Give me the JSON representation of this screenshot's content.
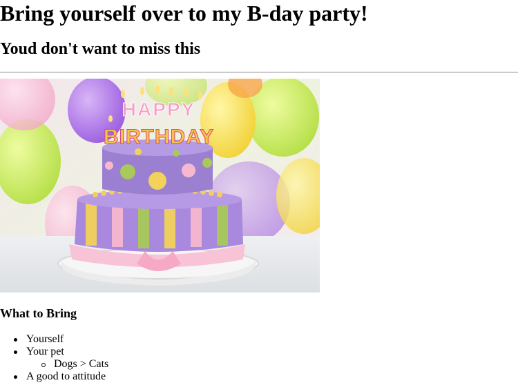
{
  "page": {
    "heading": "Bring yourself over to my B-day party!",
    "subheading": "Youd don't want to miss this",
    "image": {
      "icon": "birthday-cake-photo",
      "cake_topper_line1": "HAPPY",
      "cake_topper_line2": "BIRTHDAY"
    },
    "list_title": "What to Bring",
    "items": [
      {
        "label": "Yourself"
      },
      {
        "label": "Your pet",
        "sub_items": [
          {
            "label": "Dogs > Cats"
          }
        ]
      },
      {
        "label": "A good to attitude"
      }
    ]
  },
  "colors": {
    "text": "#000000",
    "background": "#ffffff",
    "rule": "#9a9a9a",
    "cake_purple": "#9b7fd1",
    "cake_yellow": "#f2d25a",
    "cake_green": "#a9c95a",
    "cake_pink": "#f7b7cf"
  }
}
